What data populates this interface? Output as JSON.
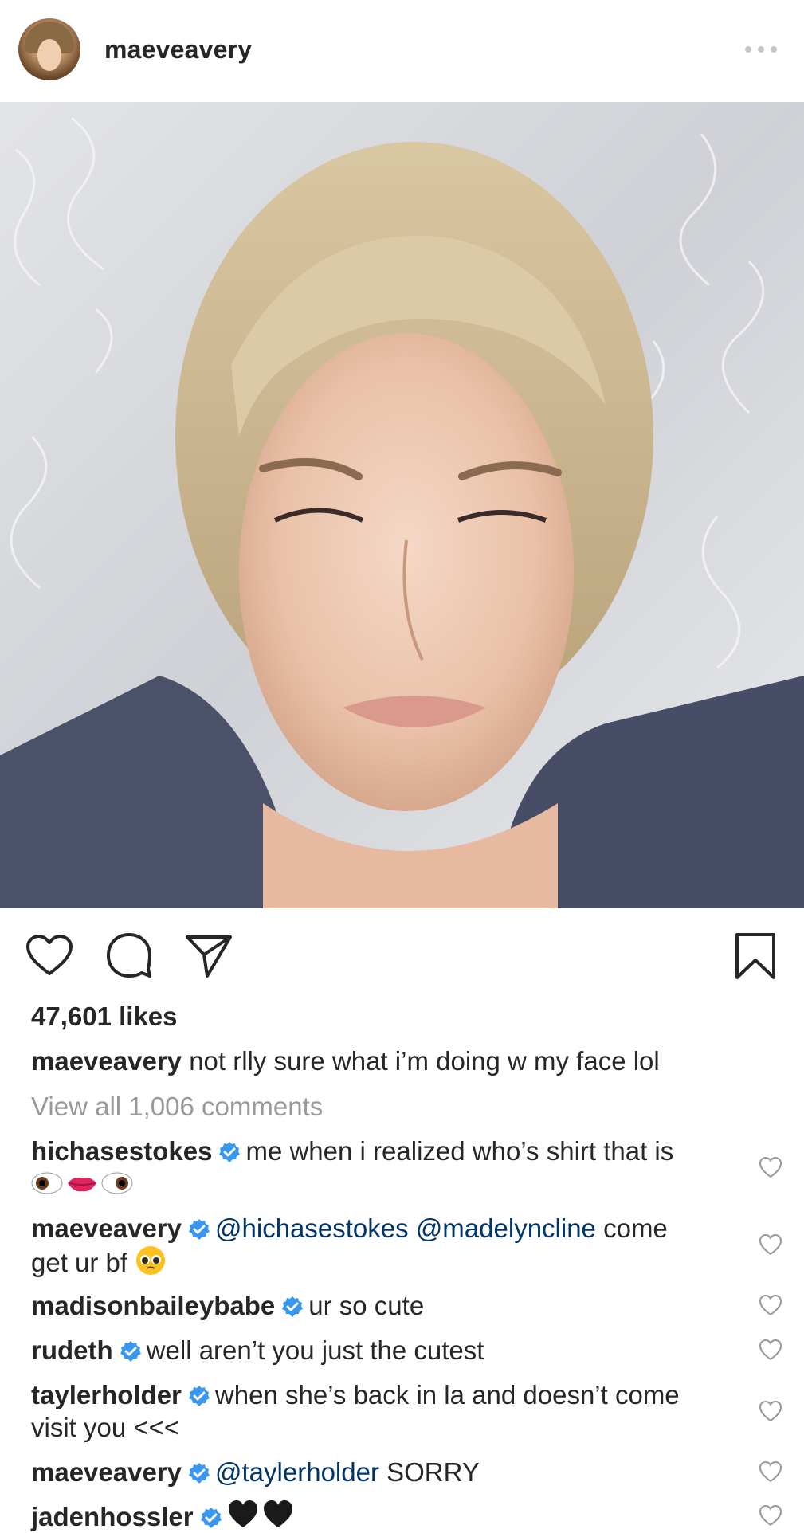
{
  "post": {
    "author": "maeveavery",
    "likes": "47,601 likes",
    "caption_user": "maeveavery",
    "caption_text": "not rlly sure what i’m doing w my face lol",
    "view_all": "View all 1,006 comments"
  },
  "icons": {
    "more": "more-dots-icon",
    "like": "heart-outline-icon",
    "comment": "comment-bubble-icon",
    "share": "paper-plane-icon",
    "save": "bookmark-icon",
    "verified": "verified-badge-icon"
  },
  "colors": {
    "text": "#262626",
    "muted": "#999999",
    "mention": "#003569",
    "verified": "#3897f0"
  },
  "comments": [
    {
      "user": "hichasestokes",
      "verified": true,
      "text": "me when i realized who’s shirt that is",
      "emojis": [
        "eyes-left-icon",
        "lips-icon",
        "eyes-right-icon"
      ]
    },
    {
      "user": "maeveavery",
      "verified": true,
      "mention1": "@hichasestokes",
      "mention2": "@madelyncline",
      "text_after": "come",
      "line2": "get ur bf",
      "emojis": [
        "pleading-face-icon"
      ]
    },
    {
      "user": "madisonbaileybabe",
      "verified": true,
      "text": "ur so cute"
    },
    {
      "user": "rudeth",
      "verified": true,
      "text": "well aren’t you just the cutest"
    },
    {
      "user": "taylerholder",
      "verified": true,
      "text": "when she’s back in la and doesn’t come",
      "line2": "visit you <<<"
    },
    {
      "user": "maeveavery",
      "verified": true,
      "mention1": "@taylerholder",
      "text": "SORRY"
    },
    {
      "user": "jadenhossler",
      "verified": true,
      "emojis": [
        "black-heart-icon",
        "black-heart-icon"
      ]
    }
  ]
}
